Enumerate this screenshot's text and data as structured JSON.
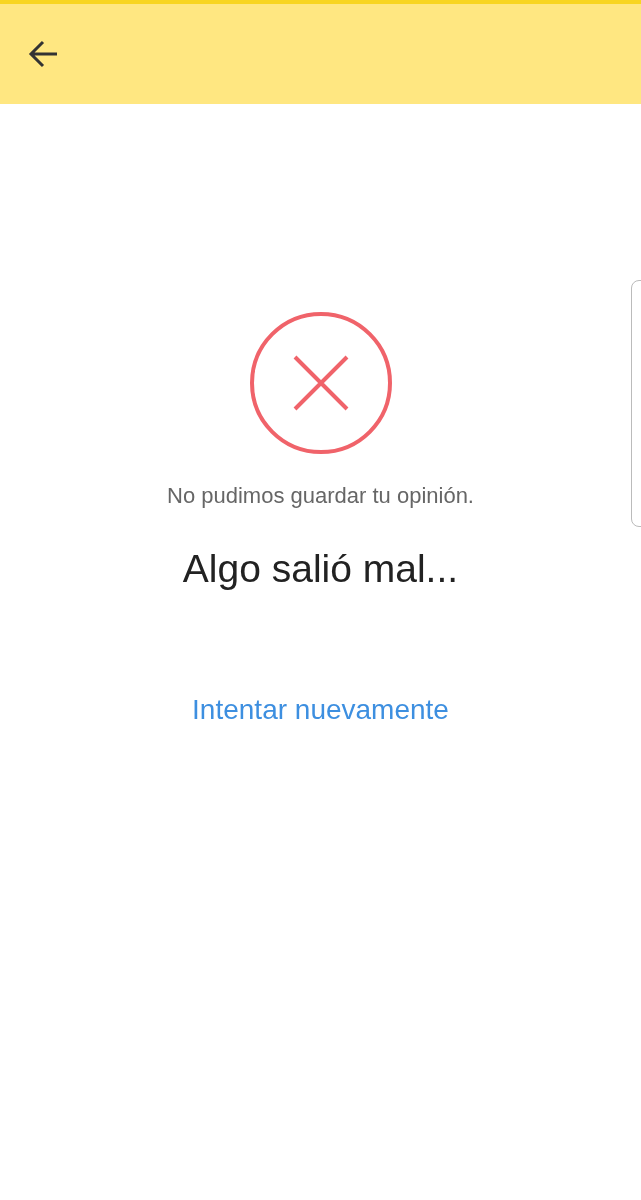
{
  "message": "No pudimos guardar tu opinión.",
  "title": "Algo salió mal...",
  "retry_link": "Intentar nuevamente"
}
